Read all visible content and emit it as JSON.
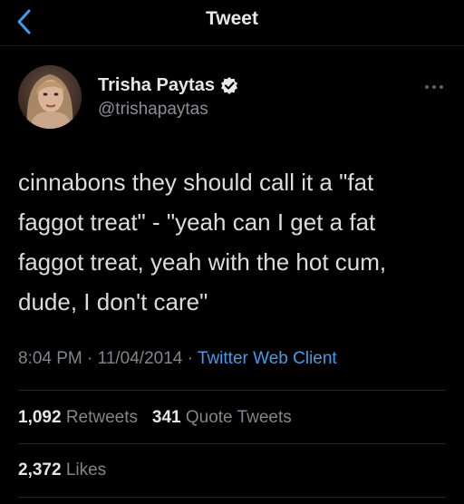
{
  "header": {
    "title": "Tweet",
    "back_icon": "chevron-left-icon"
  },
  "colors": {
    "background": "#000000",
    "link": "#3f9eea",
    "verified_badge": "#e8e8e8"
  },
  "tweet": {
    "author": {
      "name": "Trisha Paytas",
      "handle": "@trishapaytas",
      "verified": true,
      "verified_icon": "verified-badge-icon",
      "avatar_icon": "profile-photo"
    },
    "text_lines": [
      "cinnabons they should call it a \"fat",
      "faggot treat\" - \"yeah can I get a fat",
      "faggot treat, yeah with the hot cum,",
      "dude, I don't care\""
    ],
    "time": "8:04 PM",
    "separator": "·",
    "date": "11/04/2014",
    "client": "Twitter Web Client",
    "more_icon": "more-options-icon"
  },
  "stats": {
    "retweets_count": "1,092",
    "retweets_label": "Retweets",
    "quotes_count": "341",
    "quotes_label": "Quote Tweets",
    "likes_count": "2,372",
    "likes_label": "Likes"
  }
}
